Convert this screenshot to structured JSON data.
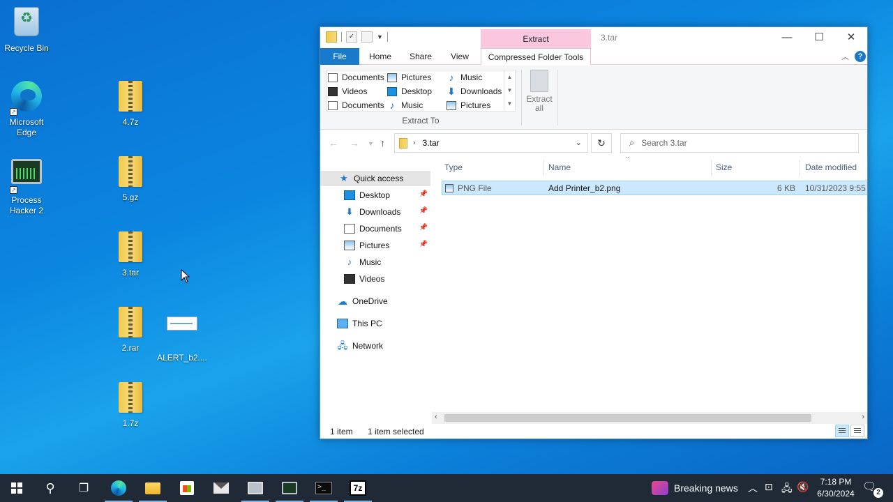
{
  "desktop": {
    "icons": [
      {
        "label": "Recycle Bin",
        "icon": "recycle-bin-icon"
      },
      {
        "label": "Microsoft Edge",
        "icon": "edge-icon"
      },
      {
        "label": "Process Hacker 2",
        "icon": "process-hacker-icon"
      },
      {
        "label": "4.7z",
        "icon": "zip-folder-icon"
      },
      {
        "label": "5.gz",
        "icon": "zip-folder-icon"
      },
      {
        "label": "3.tar",
        "icon": "zip-folder-icon"
      },
      {
        "label": "2.rar",
        "icon": "zip-folder-icon"
      },
      {
        "label": "ALERT_b2....",
        "icon": "image-file-icon"
      },
      {
        "label": "1.7z",
        "icon": "zip-folder-icon"
      }
    ]
  },
  "explorer": {
    "title": "3.tar",
    "contextual_tab": "Extract",
    "tabs": [
      "File",
      "Home",
      "Share",
      "View",
      "Compressed Folder Tools"
    ],
    "destinations": [
      {
        "label": "Documents",
        "icon": "documents-icon"
      },
      {
        "label": "Pictures",
        "icon": "pictures-icon"
      },
      {
        "label": "Music",
        "icon": "music-icon"
      },
      {
        "label": "Videos",
        "icon": "videos-icon"
      },
      {
        "label": "Desktop",
        "icon": "desktop-icon"
      },
      {
        "label": "Downloads",
        "icon": "downloads-icon"
      },
      {
        "label": "Documents",
        "icon": "documents-icon"
      },
      {
        "label": "Music",
        "icon": "music-icon"
      },
      {
        "label": "Pictures",
        "icon": "pictures-icon"
      }
    ],
    "extract_to_label": "Extract To",
    "extract_all": {
      "line1": "Extract",
      "line2": "all"
    },
    "address": {
      "path": "3.tar"
    },
    "search": {
      "placeholder": "Search 3.tar"
    },
    "nav": {
      "quick_access": "Quick access",
      "items": [
        {
          "label": "Desktop",
          "pinned": true
        },
        {
          "label": "Downloads",
          "pinned": true
        },
        {
          "label": "Documents",
          "pinned": true
        },
        {
          "label": "Pictures",
          "pinned": true
        },
        {
          "label": "Music",
          "pinned": false
        },
        {
          "label": "Videos",
          "pinned": false
        }
      ],
      "onedrive": "OneDrive",
      "this_pc": "This PC",
      "network": "Network"
    },
    "columns": {
      "type": "Type",
      "name": "Name",
      "size": "Size",
      "date": "Date modified"
    },
    "files": [
      {
        "type": "PNG File",
        "name": "Add Printer_b2.png",
        "size": "6 KB",
        "date": "10/31/2023 9:55 P"
      }
    ],
    "status": {
      "count": "1 item",
      "selected": "1 item selected"
    }
  },
  "taskbar": {
    "news": "Breaking news",
    "time": "7:18 PM",
    "date": "6/30/2024",
    "notifications": "2"
  }
}
